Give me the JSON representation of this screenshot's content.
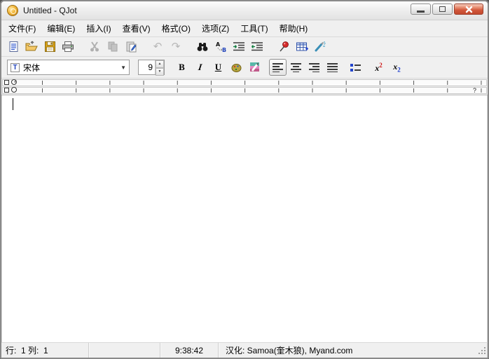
{
  "window": {
    "title": "Untitled - QJot"
  },
  "menu_bar": {
    "items": [
      {
        "label": "文件(F)"
      },
      {
        "label": "编辑(E)"
      },
      {
        "label": "插入(I)"
      },
      {
        "label": "查看(V)"
      },
      {
        "label": "格式(O)"
      },
      {
        "label": "选项(Z)"
      },
      {
        "label": "工具(T)"
      },
      {
        "label": "帮助(H)"
      }
    ]
  },
  "toolbar": {
    "buttons": [
      "new-document",
      "open-folder",
      "save-floppy",
      "print",
      "cut",
      "copy",
      "paste",
      "undo",
      "redo",
      "find-binoculars",
      "replace",
      "indent-increase",
      "indent-decrease",
      "pushpin",
      "insert-table",
      "format-brush"
    ],
    "disabled": [
      "cut",
      "copy",
      "undo",
      "redo"
    ]
  },
  "icons": {
    "undo_glyph": "↶",
    "redo_glyph": "↷",
    "dropdown_glyph": "▼",
    "spin_up_glyph": "▲",
    "spin_down_glyph": "▼",
    "tt_glyph": "T",
    "replace_from": "A",
    "replace_to": "B"
  },
  "format_bar": {
    "font_name": "宋体",
    "font_size": "9",
    "bold_label": "B",
    "italic_label": "I",
    "underline_label": "U",
    "script_base": "x",
    "superscript_mark": "2",
    "subscript_mark": "2"
  },
  "ruler": {
    "right_marker": "?"
  },
  "editor": {
    "content": ""
  },
  "status_bar": {
    "line_col": "行:  1 列:  1",
    "time": "9:38:42",
    "localization": "汉化: Samoa(奎木狼), Myand.com"
  }
}
